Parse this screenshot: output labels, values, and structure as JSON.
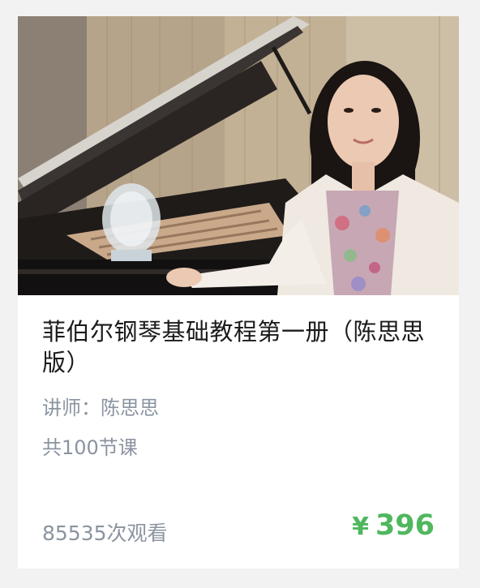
{
  "course": {
    "cover_alt": "钢琴老师与钢琴",
    "title": "菲伯尔钢琴基础教程第一册（陈思思版）",
    "teacher": "讲师：陈思思",
    "lessons": "共100节课",
    "views": "85535次观看",
    "currency": "¥",
    "price": "396"
  },
  "colors": {
    "price": "#4fb75e",
    "meta_text": "#8a94a0",
    "title_text": "#1b1b1b",
    "background": "#f2f2f2",
    "card": "#ffffff"
  }
}
